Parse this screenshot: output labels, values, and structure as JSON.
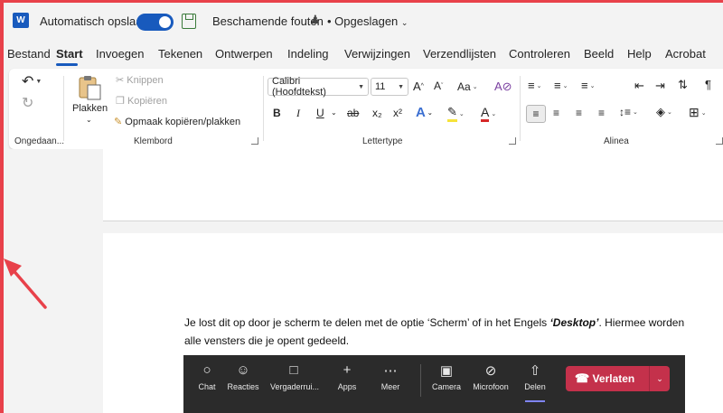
{
  "titlebar": {
    "app_icon": "W",
    "autosave_label": "Automatisch opslaan",
    "doc_title": "Beschamende fouten",
    "save_status": "• Opgeslagen",
    "colors": {
      "accent": "#185abd",
      "frame": "#e8414a"
    }
  },
  "tabs": [
    "Bestand",
    "Start",
    "Invoegen",
    "Tekenen",
    "Ontwerpen",
    "Indeling",
    "Verwijzingen",
    "Verzendlijsten",
    "Controleren",
    "Beeld",
    "Help",
    "Acrobat"
  ],
  "active_tab": "Start",
  "ribbon": {
    "undo": {
      "label": "Ongedaan..."
    },
    "clipboard": {
      "paste": "Plakken",
      "cut": "Knippen",
      "copy": "Kopiëren",
      "format_painter": "Opmaak kopiëren/plakken",
      "group": "Klembord"
    },
    "font": {
      "font_name": "Calibri (Hoofdtekst)",
      "font_size": "11",
      "case_label": "Aa",
      "bold": "B",
      "italic": "I",
      "underline": "U",
      "strike": "ab",
      "subscript": "x₂",
      "superscript": "x²",
      "group": "Lettertype"
    },
    "paragraph": {
      "group": "Alinea"
    }
  },
  "document": {
    "paragraph_before": "Je lost dit op door je scherm te delen met de optie ‘Scherm’ of in het Engels ",
    "paragraph_em": "‘Desktop’",
    "paragraph_after": ". Hiermee worden alle vensters die je opent gedeeld."
  },
  "teams_toolbar": {
    "buttons": [
      {
        "label": "Chat",
        "icon": "chat-icon"
      },
      {
        "label": "Reacties",
        "icon": "reactions-icon"
      },
      {
        "label": "Vergaderrui...",
        "icon": "rooms-icon"
      },
      {
        "label": "Apps",
        "icon": "plus-icon"
      },
      {
        "label": "Meer",
        "icon": "more-icon"
      },
      {
        "label": "Camera",
        "icon": "camera-off-icon"
      },
      {
        "label": "Microfoon",
        "icon": "mic-off-icon"
      },
      {
        "label": "Delen",
        "icon": "share-icon"
      }
    ],
    "leave_label": "Verlaten",
    "leave_color": "#c4314b"
  }
}
